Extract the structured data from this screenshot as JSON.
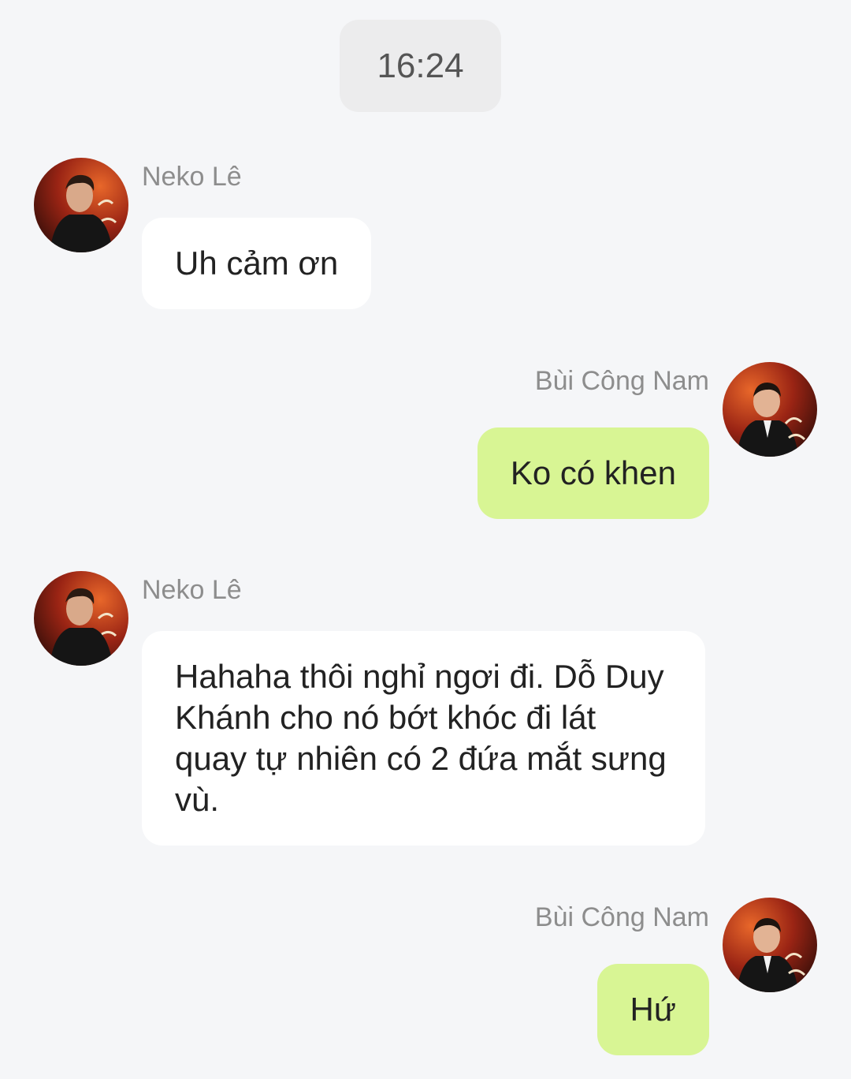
{
  "header": {
    "time": "16:24"
  },
  "messages": [
    {
      "sender": "Neko Lê",
      "direction": "incoming",
      "text": "Uh cảm ơn",
      "avatar": "avatar-neko-le"
    },
    {
      "sender": "Bùi Công Nam",
      "direction": "outgoing",
      "text": "Ko có khen",
      "avatar": "avatar-bui-cong-nam"
    },
    {
      "sender": "Neko Lê",
      "direction": "incoming",
      "text": "Hahaha thôi nghỉ ngơi đi. Dỗ Duy Khánh cho nó bớt khóc đi lát quay tự nhiên có 2 đứa mắt sưng vù.",
      "avatar": "avatar-neko-le"
    },
    {
      "sender": "Bùi Công Nam",
      "direction": "outgoing",
      "text": "Hứ",
      "avatar": "avatar-bui-cong-nam"
    }
  ],
  "colors": {
    "background": "#f5f6f8",
    "incoming_bubble": "#ffffff",
    "outgoing_bubble": "#d8f594",
    "sender_name": "#8d8d8d",
    "time_pill": "#ececed"
  }
}
